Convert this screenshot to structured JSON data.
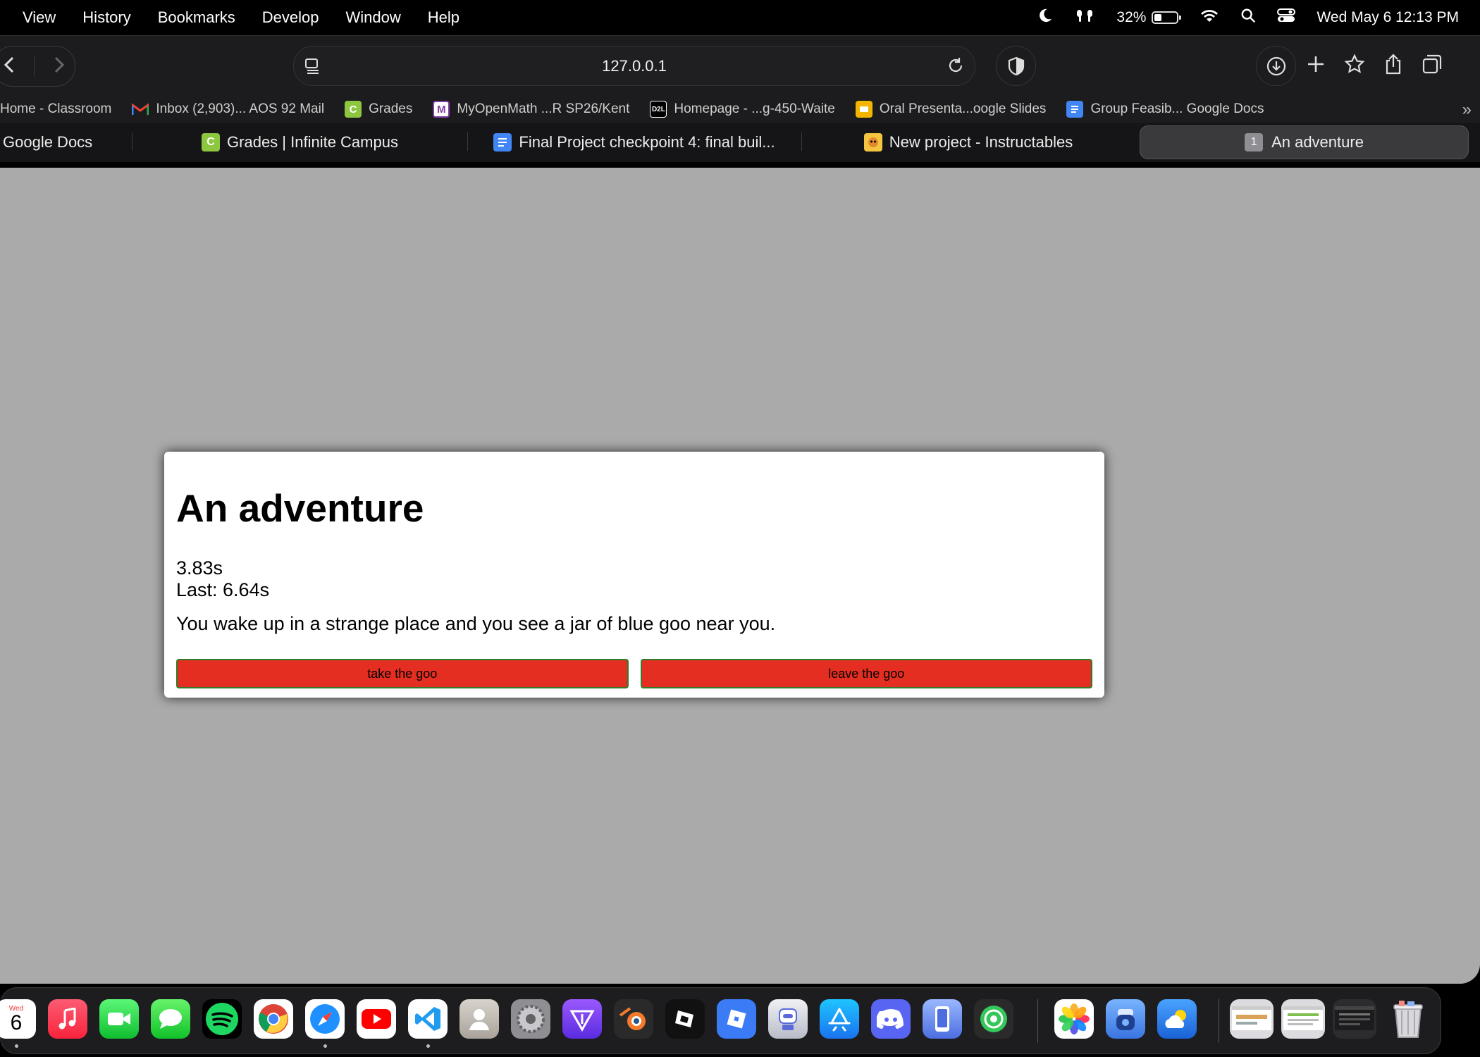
{
  "menubar": {
    "items": [
      "View",
      "History",
      "Bookmarks",
      "Develop",
      "Window",
      "Help"
    ],
    "battery_percent": "32%",
    "battery_level": 0.32,
    "datetime": "Wed May 6  12:13 PM"
  },
  "toolbar": {
    "url": "127.0.0.1"
  },
  "bookmarks": [
    {
      "label": "Home - Classroom",
      "icon": "classroom-icon",
      "color": ""
    },
    {
      "label": "Inbox (2,903)... AOS 92 Mail",
      "icon": "gmail-icon",
      "color": "#ea4335"
    },
    {
      "label": "Grades",
      "icon": "infinite-campus-icon",
      "color": "#8dc63f"
    },
    {
      "label": "MyOpenMath ...R SP26/Kent",
      "icon": "myopenmath-icon",
      "color": "#7b3fa0"
    },
    {
      "label": "Homepage - ...g-450-Waite",
      "icon": "d2l-icon",
      "color": "#000000"
    },
    {
      "label": "Oral Presenta...oogle Slides",
      "icon": "google-slides-icon",
      "color": "#f4b400"
    },
    {
      "label": "Group Feasib... Google Docs",
      "icon": "google-docs-icon",
      "color": "#4285f4"
    }
  ],
  "tabs": [
    {
      "label": "Google Docs"
    },
    {
      "label": "Grades | Infinite Campus"
    },
    {
      "label": "Final Project checkpoint 4: final buil..."
    },
    {
      "label": "New project - Instructables"
    },
    {
      "label": "An adventure",
      "badge": "1"
    }
  ],
  "game": {
    "title": "An adventure",
    "timer": "3.83s",
    "last": "Last: 6.64s",
    "story": "You wake up in a strange place and you see a jar of blue goo near you.",
    "choices": [
      "take the goo",
      "leave the goo"
    ]
  },
  "dock": {
    "calendar_day": "Wed",
    "calendar_date": "6"
  },
  "colors": {
    "page_bg": "#aaaaaa",
    "button_bg": "#e52e22",
    "button_border": "#2f7d2a"
  }
}
